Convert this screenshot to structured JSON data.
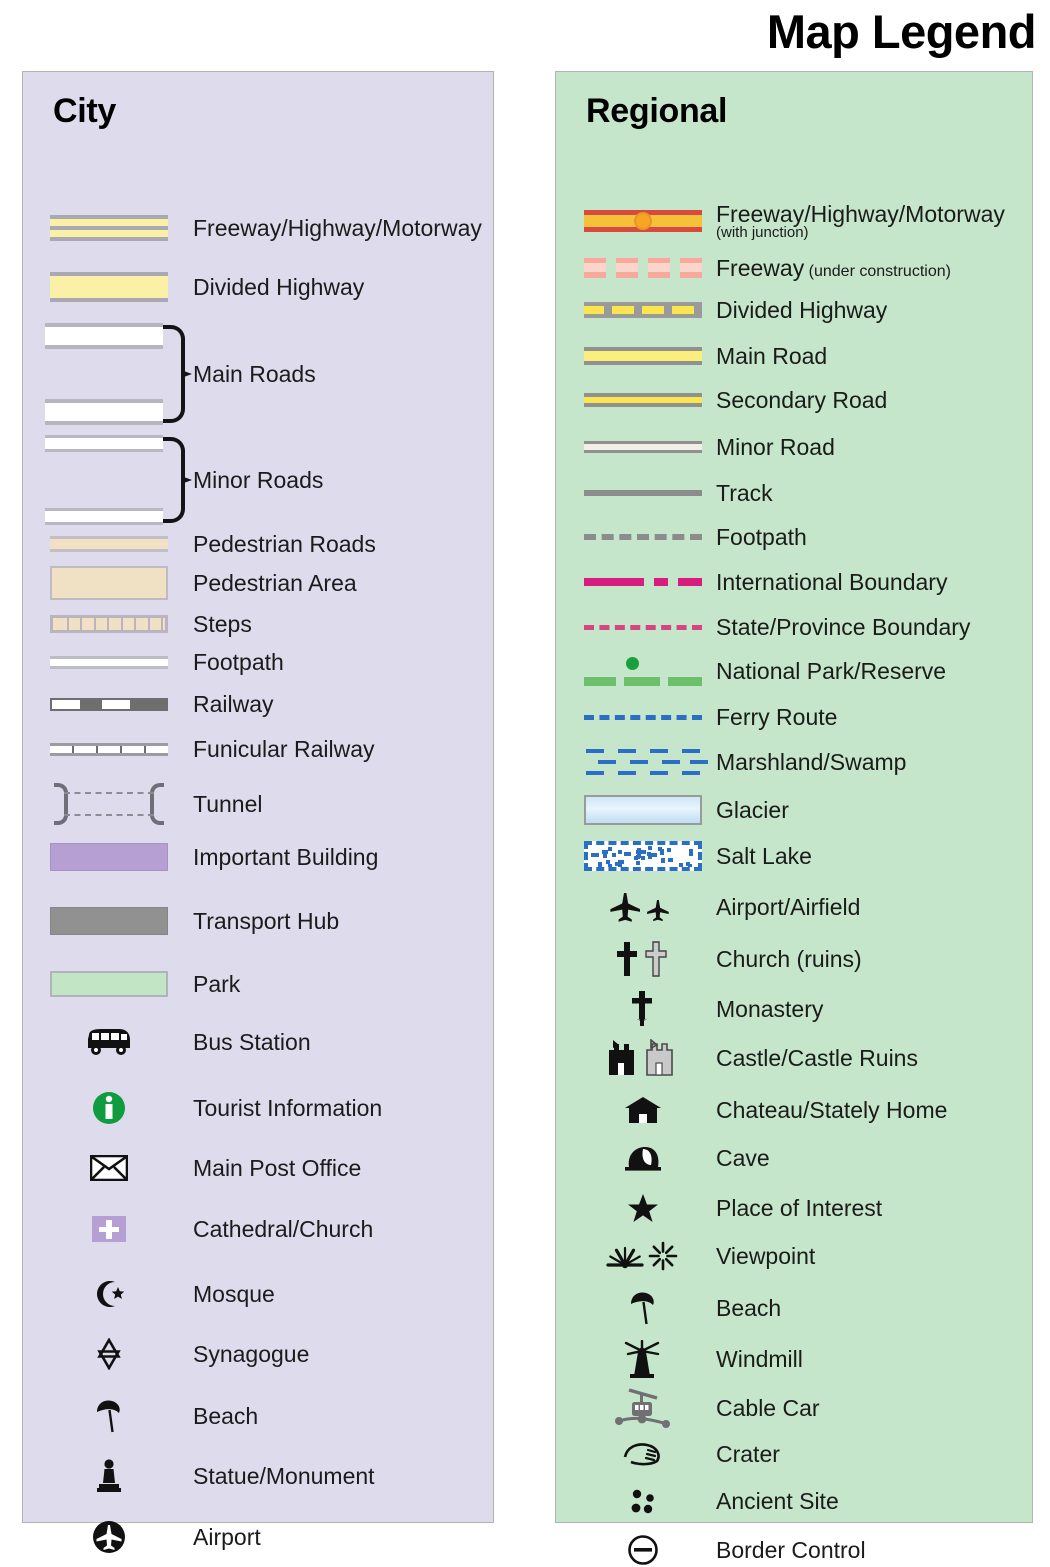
{
  "title": "Map Legend",
  "panels": {
    "city": {
      "heading": "City",
      "background_color": "#dedbec",
      "items": [
        {
          "label": "Freeway/Highway/Motorway",
          "symbol": "freeway-double-band"
        },
        {
          "label": "Divided Highway",
          "symbol": "divided-highway-band"
        },
        {
          "label": "Main Roads",
          "symbol": "main-roads-braced-pair"
        },
        {
          "label": "Minor Roads",
          "symbol": "minor-roads-braced-pair"
        },
        {
          "label": "Pedestrian Roads",
          "symbol": "pedestrian-road-band"
        },
        {
          "label": "Pedestrian Area",
          "symbol": "pedestrian-area-block"
        },
        {
          "label": "Steps",
          "symbol": "steps-hatched-band"
        },
        {
          "label": "Footpath",
          "symbol": "footpath-thin-band"
        },
        {
          "label": "Railway",
          "symbol": "railway-dashed-band"
        },
        {
          "label": "Funicular Railway",
          "symbol": "funicular-ticked-band"
        },
        {
          "label": "Tunnel",
          "symbol": "tunnel-brackets"
        },
        {
          "label": "Important Building",
          "symbol": "important-building-swatch"
        },
        {
          "label": "Transport Hub",
          "symbol": "transport-hub-swatch"
        },
        {
          "label": "Park",
          "symbol": "park-swatch"
        },
        {
          "label": "Bus Station",
          "symbol": "bus-icon"
        },
        {
          "label": "Tourist Information",
          "symbol": "information-circle-icon"
        },
        {
          "label": "Main Post Office",
          "symbol": "envelope-icon"
        },
        {
          "label": "Cathedral/Church",
          "symbol": "church-cross-square-icon"
        },
        {
          "label": "Mosque",
          "symbol": "crescent-star-icon"
        },
        {
          "label": "Synagogue",
          "symbol": "star-of-david-icon"
        },
        {
          "label": "Beach",
          "symbol": "parasol-icon"
        },
        {
          "label": "Statue/Monument",
          "symbol": "statue-icon"
        },
        {
          "label": "Airport",
          "symbol": "airplane-circle-icon"
        }
      ]
    },
    "regional": {
      "heading": "Regional",
      "background_color": "#c5e6ca",
      "items": [
        {
          "label": "Freeway/Highway/Motorway",
          "sub": "(with junction)",
          "sub_block": true,
          "symbol": "freeway-junction-line"
        },
        {
          "label": "Freeway",
          "sub": "(under construction)",
          "sub_block": false,
          "symbol": "freeway-construction-dashes"
        },
        {
          "label": "Divided Highway",
          "symbol": "divided-highway-line"
        },
        {
          "label": "Main Road",
          "symbol": "main-road-line"
        },
        {
          "label": "Secondary Road",
          "symbol": "secondary-road-line"
        },
        {
          "label": "Minor Road",
          "symbol": "minor-road-line"
        },
        {
          "label": "Track",
          "symbol": "track-line"
        },
        {
          "label": "Footpath",
          "symbol": "footpath-dashed-line"
        },
        {
          "label": "International Boundary",
          "symbol": "international-boundary-line"
        },
        {
          "label": "State/Province Boundary",
          "symbol": "state-boundary-line"
        },
        {
          "label": "National Park/Reserve",
          "symbol": "national-park-line"
        },
        {
          "label": "Ferry Route",
          "symbol": "ferry-route-line"
        },
        {
          "label": "Marshland/Swamp",
          "symbol": "marshland-pattern"
        },
        {
          "label": "Glacier",
          "symbol": "glacier-swatch"
        },
        {
          "label": "Salt Lake",
          "symbol": "salt-lake-swatch"
        },
        {
          "label": "Airport/Airfield",
          "symbol": "airplane-pair-icon"
        },
        {
          "label": "Church (ruins)",
          "symbol": "cross-pair-icon"
        },
        {
          "label": "Monastery",
          "symbol": "orthodox-cross-icon"
        },
        {
          "label": "Castle/Castle Ruins",
          "symbol": "castle-pair-icon"
        },
        {
          "label": "Chateau/Stately Home",
          "symbol": "chateau-icon"
        },
        {
          "label": "Cave",
          "symbol": "cave-icon"
        },
        {
          "label": "Place of Interest",
          "symbol": "star-icon"
        },
        {
          "label": "Viewpoint",
          "symbol": "viewpoint-burst-icon"
        },
        {
          "label": "Beach",
          "symbol": "parasol-icon"
        },
        {
          "label": "Windmill",
          "symbol": "windmill-icon"
        },
        {
          "label": "Cable Car",
          "symbol": "cable-car-icon"
        },
        {
          "label": "Crater",
          "symbol": "crater-icon"
        },
        {
          "label": "Ancient Site",
          "symbol": "ancient-site-dots-icon"
        },
        {
          "label": "Border Control",
          "symbol": "border-control-icon"
        }
      ]
    }
  },
  "colors": {
    "city_panel": "#dedbec",
    "regional_panel": "#c5e6ca",
    "highway_yellow": "#faf0a6",
    "road_casing_grey": "#a9a9b4",
    "pedestrian_beige": "#f0e0c4",
    "important_building_purple": "#b69fd2",
    "transport_hub_grey": "#919191",
    "park_green": "#c2e5c6",
    "freeway_red": "#d94a3e",
    "freeway_fill": "#f5c13a",
    "junction_orange": "#f5a623",
    "construction_pink": "#f9a99a",
    "main_road_yellow": "#fbef7b",
    "secondary_yellow": "#fbe54d",
    "minor_road_cream": "#f2efe6",
    "track_grey": "#8c8c8c",
    "international_magenta": "#d81b7f",
    "state_boundary_pink": "#d8447f",
    "national_park_green": "#6cc06c",
    "park_dot_green": "#19a03c",
    "ferry_blue": "#2a6fc4",
    "glacier_blue": "#cfe6f7",
    "tourist_info_green": "#0f9b40"
  }
}
